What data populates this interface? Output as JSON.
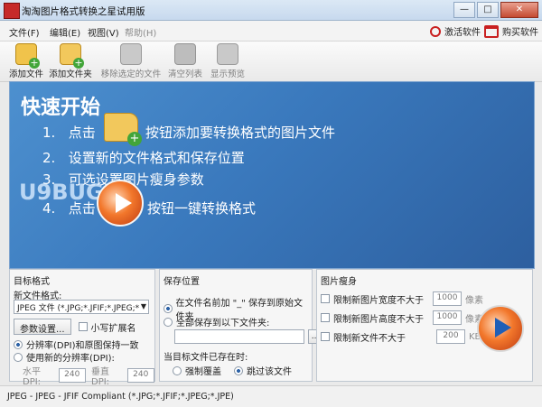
{
  "window": {
    "title": "淘淘图片格式转换之星试用版",
    "buttons": [
      "—",
      "□",
      "✕"
    ]
  },
  "menubar": {
    "items": [
      {
        "label": "文件(F)",
        "disabled": false
      },
      {
        "label": "编辑(E)",
        "disabled": false
      },
      {
        "label": "视图(V)",
        "disabled": false
      },
      {
        "label": "帮助(H)",
        "disabled": true
      }
    ],
    "activate_label": "激活软件",
    "buy_label": "购买软件"
  },
  "toolbar": {
    "add_file": "添加文件",
    "add_folder": "添加文件夹",
    "remove_selected": "移除选定的文件",
    "clear_list": "清空列表",
    "show_preview": "显示预览"
  },
  "hero": {
    "title": "快速开始",
    "steps": [
      {
        "num": "1.",
        "text": "点击",
        "after": "按钮添加要转换格式的图片文件"
      },
      {
        "num": "2.",
        "text": "设置新的文件格式和保存位置"
      },
      {
        "num": "3.",
        "text": "可选设置图片瘦身参数"
      },
      {
        "num": "4.",
        "text": "点击",
        "after": "按钮一键转换格式"
      }
    ],
    "watermark": "U9BUG"
  },
  "target": {
    "title": "目标格式",
    "new_format_label": "新文件格式:",
    "format_value": "JPEG 文件 (*.JPG;*.JFIF;*.JPEG;*",
    "params_button": "参数设置...",
    "lowercase_ext": "小写扩展名",
    "dpi_keep": "分辨率(DPI)和原图保持一致",
    "dpi_new": "使用新的分辨率(DPI):",
    "h_dpi_label": "水平DPI:",
    "h_dpi_value": "240",
    "v_dpi_label": "垂直DPI:",
    "v_dpi_value": "240"
  },
  "save": {
    "title": "保存位置",
    "option_prefix": "在文件名前加 \"_\" 保存到原始文件夹",
    "option_folder": "全部保存到以下文件夹:",
    "folder_value": "",
    "browse_button": "...",
    "exists_label": "当目标文件已存在时:",
    "overwrite": "强制覆盖",
    "skip": "跳过该文件"
  },
  "slim": {
    "title": "图片瘦身",
    "limit_width": "限制新图片宽度不大于",
    "width_value": "1000",
    "width_unit": "像素",
    "limit_height": "限制新图片高度不大于",
    "height_value": "1000",
    "height_unit": "像素",
    "limit_size": "限制新文件不大于",
    "size_value": "200",
    "size_unit": "KB"
  },
  "status": {
    "text": "JPEG - JPEG - JFIF Compliant (*.JPG;*.JFIF;*.JPEG;*.JPE)"
  }
}
